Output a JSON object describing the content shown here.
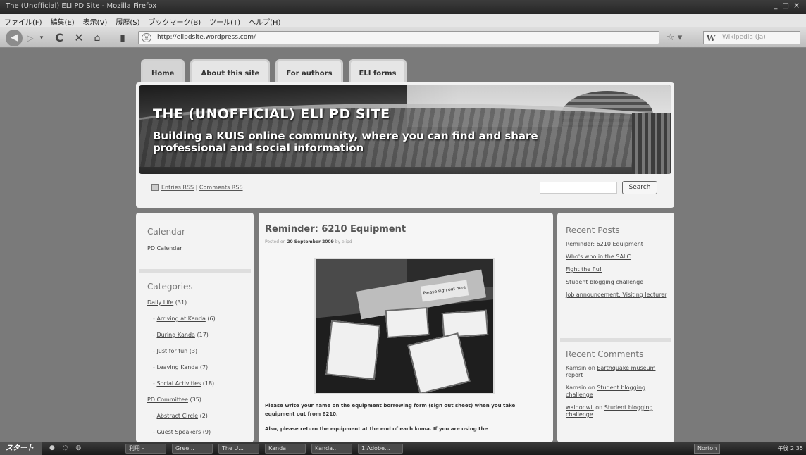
{
  "browser": {
    "window_title": "The (Unofficial) ELI PD Site - Mozilla Firefox",
    "window_controls": "_ □ X",
    "menu": [
      "ファイル(F)",
      "編集(E)",
      "表示(V)",
      "履歴(S)",
      "ブックマーク(B)",
      "ツール(T)",
      "ヘルプ(H)"
    ],
    "url": "http://elipdsite.wordpress.com/",
    "search_placeholder": "Wikipedia (ja)",
    "search_engine_glyph": "W"
  },
  "site": {
    "tabs": [
      "Home",
      "About this site",
      "For authors",
      "ELI forms"
    ],
    "title": "THE (UNOFFICIAL) ELI PD SITE",
    "description": "Building a KUIS online community, where you can find and share professional and social information",
    "feeds": {
      "entries": "Entries RSS",
      "separator": "|",
      "comments": "Comments RSS"
    },
    "search_button": "Search"
  },
  "left_sidebar": {
    "calendar_title": "Calendar",
    "calendar_link": "PD Calendar",
    "categories_title": "Categories",
    "categories": [
      {
        "label": "Daily Life",
        "count": "(31)",
        "sub": false
      },
      {
        "label": "Arriving at Kanda",
        "count": "(6)",
        "sub": true
      },
      {
        "label": "During Kanda",
        "count": "(17)",
        "sub": true
      },
      {
        "label": "Just for fun",
        "count": "(3)",
        "sub": true
      },
      {
        "label": "Leaving Kanda",
        "count": "(7)",
        "sub": true
      },
      {
        "label": "Social Activities",
        "count": "(18)",
        "sub": true
      },
      {
        "label": "PD Committee",
        "count": "(35)",
        "sub": false
      },
      {
        "label": "Abstract Circle",
        "count": "(2)",
        "sub": true
      },
      {
        "label": "Guest Speakers",
        "count": "(9)",
        "sub": true
      }
    ]
  },
  "post": {
    "title": "Reminder: 6210 Equipment",
    "meta_prefix": "Posted on",
    "date": "20 September 2009",
    "meta_by": "by",
    "author": "elipd",
    "image_sign": "Please sign out here",
    "paragraph1": "Please write your name on the equipment borrowing form (sign out sheet) when you take equipment out from 6210.",
    "paragraph2": "Also, please return the equipment at the end of each koma. If you are using the"
  },
  "right_sidebar": {
    "recent_posts_title": "Recent Posts",
    "recent_posts": [
      "Reminder: 6210 Equipment",
      "Who's who in the SALC",
      "Fight the flu!",
      "Student blogging challenge",
      "Job announcement: Visiting lecturer"
    ],
    "recent_comments_title": "Recent Comments",
    "recent_comments": [
      {
        "author": "Kamsin",
        "on": "on",
        "post": "Earthquake museum report"
      },
      {
        "author": "Kamsin",
        "on": "on",
        "post": "Student blogging challenge"
      },
      {
        "author": "waldonwil",
        "on": "on",
        "post": "Student blogging challenge"
      }
    ]
  },
  "taskbar": {
    "start": "スタート",
    "buttons": [
      "利用 -",
      "Gree...",
      "The U...",
      "Kanda",
      "Kanda...",
      "1 Adobe..."
    ],
    "tray_label": "Norton",
    "clock": "午後 2:35"
  },
  "colors": {
    "page_bg": "#7a7a7a",
    "panel_bg": "#f3f3f3",
    "title_bar": "#2f2f2f"
  }
}
